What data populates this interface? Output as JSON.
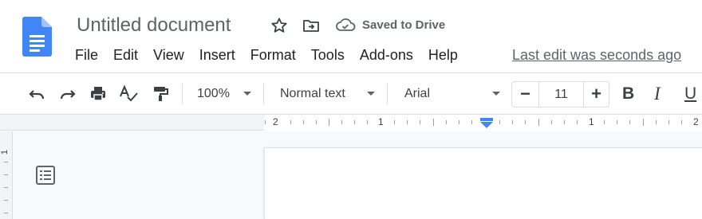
{
  "document": {
    "title": "Untitled document",
    "save_status": "Saved to Drive"
  },
  "menu": [
    "File",
    "Edit",
    "View",
    "Insert",
    "Format",
    "Tools",
    "Add-ons",
    "Help"
  ],
  "last_edit": "Last edit was seconds ago",
  "toolbar": {
    "zoom": "100%",
    "style": "Normal text",
    "font": "Arial",
    "font_size": "11",
    "minus": "−",
    "plus": "+",
    "bold": "B",
    "italic": "I",
    "underline": "U"
  },
  "ruler": {
    "labels": [
      "2",
      "1",
      "1",
      "2"
    ],
    "vertical_label": "1"
  },
  "colors": {
    "brand_blue": "#4285f4",
    "icon_gray": "#5f6368",
    "text_dark": "#202124"
  },
  "icons": [
    "docs-logo-icon",
    "star-icon",
    "move-to-folder-icon",
    "cloud-saved-icon",
    "undo-icon",
    "redo-icon",
    "print-icon",
    "spellcheck-icon",
    "paint-format-icon",
    "outline-icon"
  ]
}
